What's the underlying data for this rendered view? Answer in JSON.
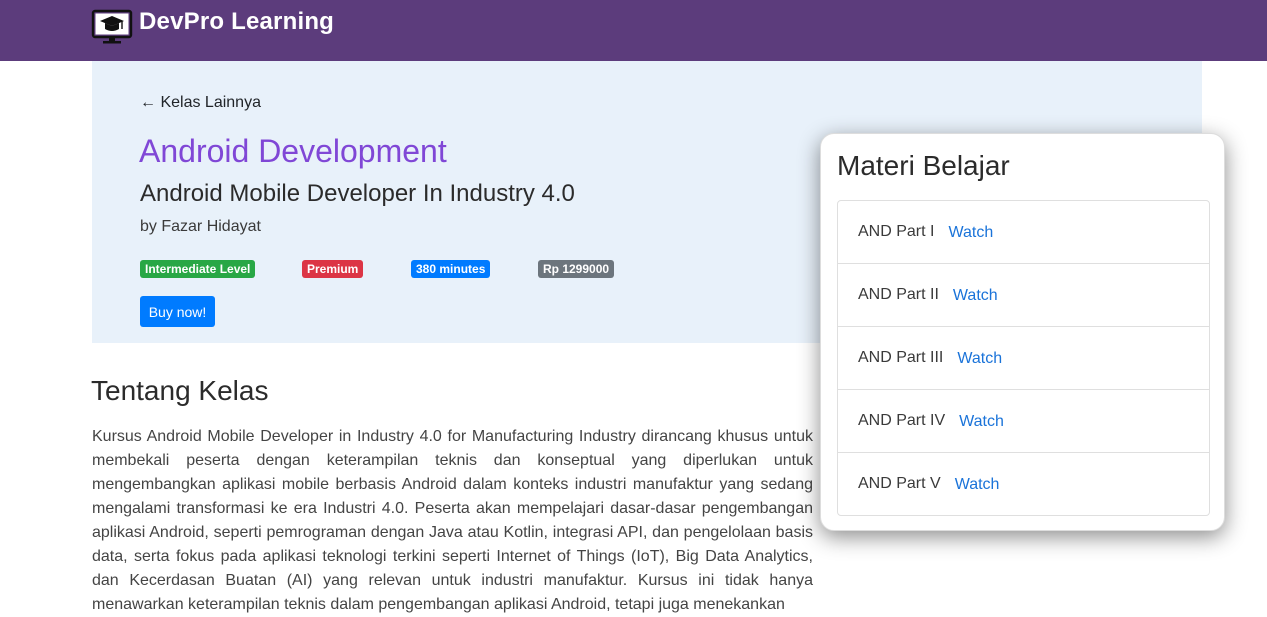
{
  "header": {
    "brand": "DevPro Learning",
    "brand_icon": "monitor-graduation-cap-icon",
    "bg_color": "#5c3c7c"
  },
  "hero": {
    "back_link": "← Kelas Lainnya",
    "title": "Android Development",
    "subtitle": "Android Mobile Developer In Industry 4.0",
    "author": "by Fazar Hidayat",
    "badges": {
      "level": "Intermediate Level",
      "tier": "Premium",
      "duration": "380 minutes",
      "price": "Rp 1299000"
    },
    "buy_button": "Buy now!",
    "title_color": "#8047d6",
    "bg_color": "#e8f1fa"
  },
  "about": {
    "title": "Tentang Kelas",
    "text": "Kursus Android Mobile Developer in Industry 4.0 for Manufacturing Industry dirancang khusus untuk membekali peserta dengan keterampilan teknis dan konseptual yang diperlukan untuk mengembangkan aplikasi mobile berbasis Android dalam konteks industri manufaktur yang sedang mengalami transformasi ke era Industri 4.0. Peserta akan mempelajari dasar-dasar pengembangan aplikasi Android, seperti pemrograman dengan Java atau Kotlin, integrasi API, dan pengelolaan basis data, serta fokus pada aplikasi teknologi terkini seperti Internet of Things (IoT), Big Data Analytics, dan Kecerdasan Buatan (AI) yang relevan untuk industri manufaktur. Kursus ini tidak hanya menawarkan keterampilan teknis dalam pengembangan aplikasi Android, tetapi juga menekankan"
  },
  "materials": {
    "title": "Materi Belajar",
    "items": [
      {
        "name": "AND Part I",
        "action": "Watch"
      },
      {
        "name": "AND Part II",
        "action": "Watch"
      },
      {
        "name": "AND Part III",
        "action": "Watch"
      },
      {
        "name": "AND Part IV",
        "action": "Watch"
      },
      {
        "name": "AND Part V",
        "action": "Watch"
      }
    ]
  }
}
